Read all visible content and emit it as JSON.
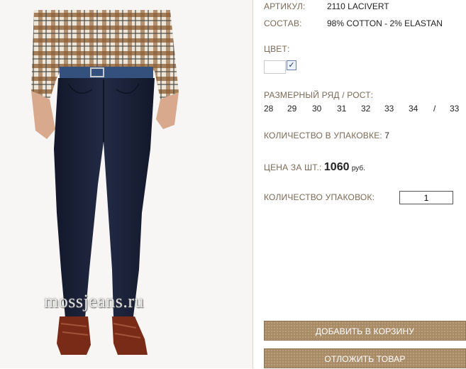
{
  "photo": {
    "watermark": "mossjeans.ru"
  },
  "product": {
    "article_label": "АРТИКУЛ:",
    "article_value": "2110 LACIVERT",
    "composition_label": "СОСТАВ:",
    "composition_value": "98% COTTON - 2% ELASTAN",
    "color_label": "ЦВЕТ:",
    "color_checked": true,
    "sizes_label": "РАЗМЕРНЫЙ РЯД / РОСТ:",
    "sizes": [
      "28",
      "29",
      "30",
      "31",
      "32",
      "33",
      "34",
      "/",
      "33"
    ],
    "pack_qty_label": "КОЛИЧЕСТВО В УПАКОВКЕ:",
    "pack_qty_value": "7",
    "price_label": "ЦЕНА ЗА ШТ.:",
    "price_value": "1060",
    "price_currency": "руб.",
    "packs_label": "КОЛИЧЕСТВО УПАКОВОК:",
    "packs_value": "1"
  },
  "actions": {
    "add_to_cart": "ДОБАВИТЬ В КОРЗИНУ",
    "postpone": "ОТЛОЖИТЬ ТОВАР"
  },
  "colors": {
    "label": "#7a6a55",
    "button": "#a98c66",
    "jeans": "#1b2136",
    "shirt_plaid": "#8a5a2e"
  }
}
